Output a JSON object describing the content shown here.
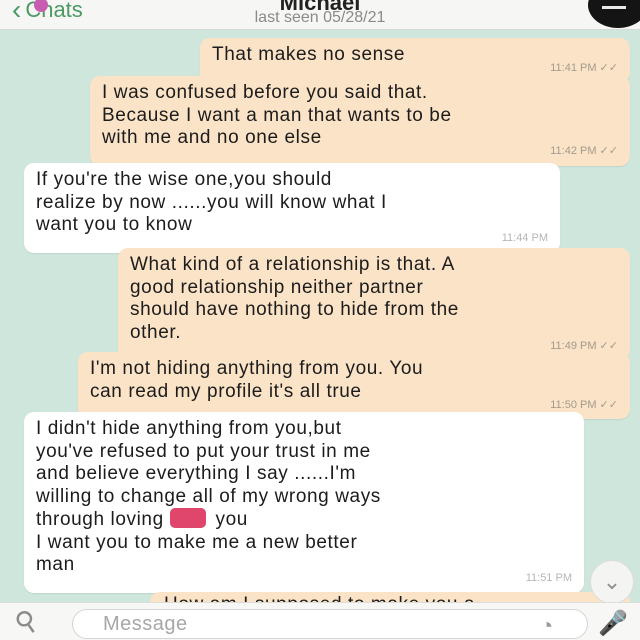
{
  "header": {
    "back_label": "Chats",
    "contact_name": "Michael",
    "last_seen": "last seen 05/28/21"
  },
  "messages": [
    {
      "direction": "out",
      "text": "That makes no sense",
      "time": "11:41 PM ✓✓"
    },
    {
      "direction": "out",
      "text": "I was confused before you said that.\nBecause I want a man that wants to be\nwith me and no one else",
      "time": "11:42 PM ✓✓"
    },
    {
      "direction": "in",
      "text": "If you're the wise one,you should\nrealize by now ......you will know what I\nwant you to know",
      "time": "11:44 PM"
    },
    {
      "direction": "out",
      "text": "What kind of a relationship is that. A\ngood relationship neither partner\nshould have nothing to hide from the\nother.",
      "time": "11:49 PM ✓✓"
    },
    {
      "direction": "out",
      "text": "I'm not hiding anything from you. You\ncan read my profile it's all true",
      "time": "11:50 PM ✓✓"
    },
    {
      "direction": "in",
      "text_before": "I didn't hide anything from you,but\nyou've refused to put your trust in me\nand believe everything I say ......I'm\nwilling to change all of my wrong ways\nthrough loving ",
      "emoji": "heart-emoji",
      "text_after": " you\nI want you to make me a new better\nman",
      "time": "11:51 PM"
    }
  ],
  "partial_message": "How am I supposed to make you a",
  "input": {
    "placeholder": "Message"
  },
  "icons": {
    "back": "chevron-left-icon",
    "attach": "paperclip-icon",
    "sticker": "sticker-icon",
    "voice": "microphone-icon",
    "scroll": "chevron-down-icon"
  },
  "colors": {
    "background": "#cfe6dd",
    "outgoing_bubble": "#fbe3c7",
    "incoming_bubble": "#ffffff",
    "accent": "#4a9a62"
  }
}
